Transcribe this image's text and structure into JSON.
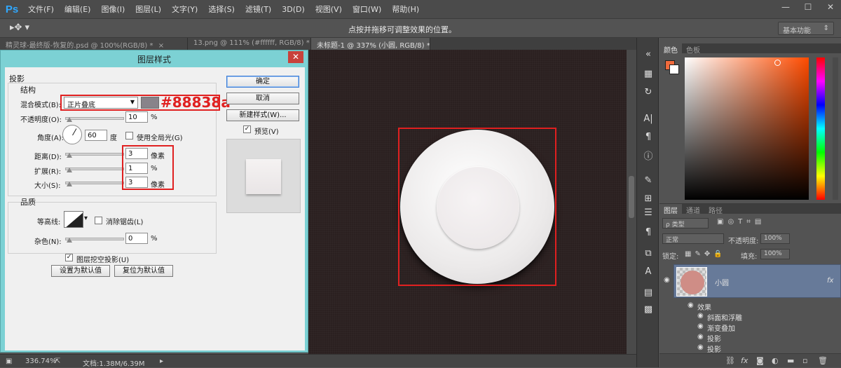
{
  "app": {
    "logo": "Ps",
    "menu": [
      "文件(F)",
      "编辑(E)",
      "图像(I)",
      "图层(L)",
      "文字(Y)",
      "选择(S)",
      "滤镜(T)",
      "3D(D)",
      "视图(V)",
      "窗口(W)",
      "帮助(H)"
    ],
    "window_controls": [
      "—",
      "☐",
      "✕"
    ]
  },
  "options_bar": {
    "hint": "点按并拖移可调整效果的位置。",
    "workspace": "基本功能"
  },
  "tabs": [
    {
      "label": "精灵球-最终版-恢复的.psd @ 100%(RGB/8) *",
      "close": "×"
    },
    {
      "label": "13.png @ 111% (#ffffff, RGB/8) *",
      "close": "×"
    },
    {
      "label": "未标题-1 @ 337% (小圆, RGB/8) *",
      "close": "×"
    }
  ],
  "status": {
    "zoom": "336.74%",
    "doc": "文档:1.38M/6.39M"
  },
  "dialog": {
    "title": "图层样式",
    "close": "✕",
    "section": "投影",
    "structure_label": "结构",
    "blend_mode_label": "混合模式(B):",
    "blend_mode_value": "正片叠底",
    "shadow_color": "#88838a",
    "hex_annotation": "#88838a",
    "opacity_label": "不透明度(O):",
    "opacity_value": "10",
    "opacity_unit": "%",
    "angle_label": "角度(A):",
    "angle_value": "60",
    "angle_unit": "度",
    "global_light_label": "使用全局光(G)",
    "global_light_checked": false,
    "distance_label": "距离(D):",
    "distance_value": "3",
    "distance_unit": "像素",
    "spread_label": "扩展(R):",
    "spread_value": "1",
    "spread_unit": "%",
    "size_label": "大小(S):",
    "size_value": "3",
    "size_unit": "像素",
    "quality_label": "品质",
    "contour_label": "等高线:",
    "anti_alias_label": "消除锯齿(L)",
    "noise_label": "杂色(N):",
    "noise_value": "0",
    "noise_unit": "%",
    "knockout_label": "图层挖空投影(U)",
    "knockout_checked": true,
    "set_default": "设置为默认值",
    "reset_default": "复位为默认值",
    "ok": "确定",
    "cancel": "取消",
    "new_style": "新建样式(W)...",
    "preview_label": "预览(V)",
    "preview_checked": true
  },
  "color_panel": {
    "tabs": [
      "颜色",
      "色板"
    ],
    "foreground": "#f06a3c",
    "background": "#ffffff"
  },
  "layers_panel": {
    "tabs": [
      "图层",
      "通道",
      "路径"
    ],
    "filter_kind": "ρ 类型",
    "blend_mode": "正常",
    "opacity_label": "不透明度:",
    "opacity_value": "100%",
    "lock_label": "锁定:",
    "fill_label": "填充:",
    "fill_value": "100%",
    "layer_name": "小圆",
    "fx_badge": "fx",
    "effects_label": "效果",
    "effects": [
      "斜面和浮雕",
      "渐变叠加",
      "投影",
      "投影"
    ]
  }
}
